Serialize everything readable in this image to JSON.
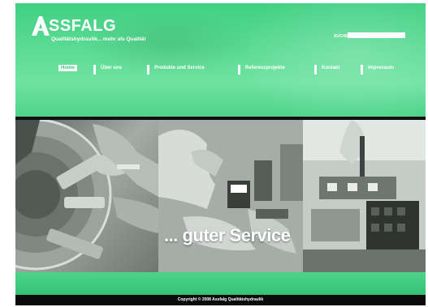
{
  "brand": {
    "name": "SSFALG",
    "tagline": "Qualitätshydraulik... mehr als Qualität",
    "accent_color": "#55d88f"
  },
  "search": {
    "label": "SUCHE",
    "value": ""
  },
  "nav": {
    "items": [
      {
        "label": "Home",
        "active": true
      },
      {
        "label": "Über uns"
      },
      {
        "label": "Produkte und Service"
      },
      {
        "label": "Referenzprojekte"
      },
      {
        "label": "Kontakt"
      },
      {
        "label": "Impressum"
      }
    ]
  },
  "hero": {
    "headline": "... guter Service"
  },
  "footer": {
    "copyright": "Copyright © 2008 Assfalg Qualitätshydraulik"
  }
}
